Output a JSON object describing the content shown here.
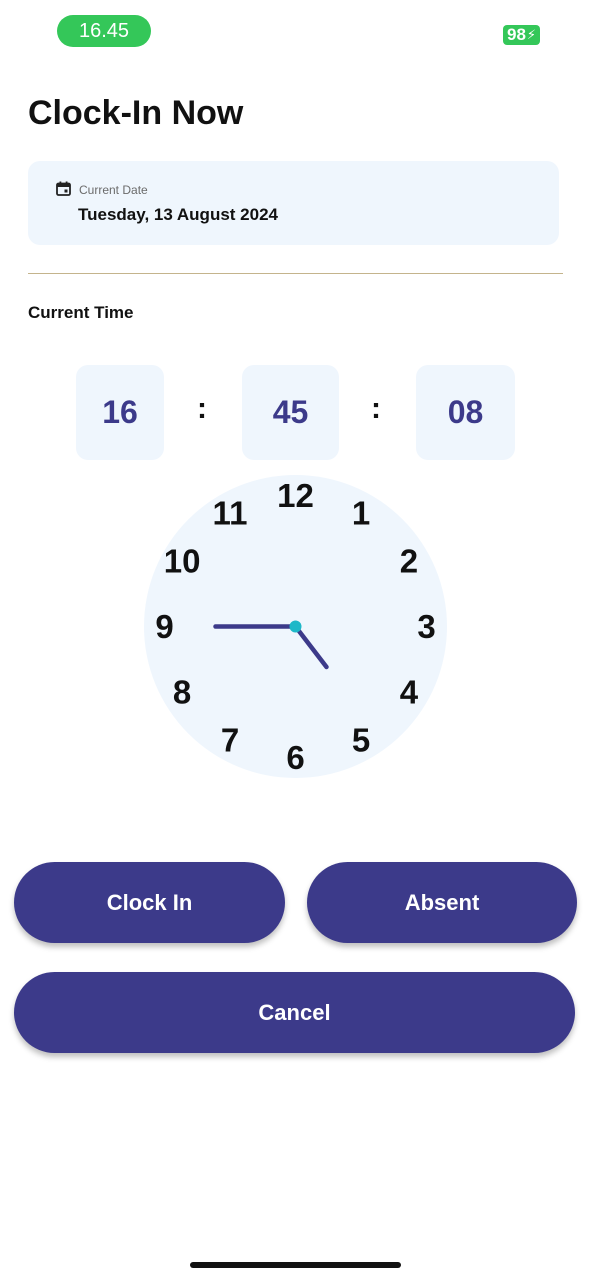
{
  "status_bar": {
    "time": "16.45",
    "battery": "98",
    "battery_icon": "bolt-icon",
    "pill_color": "#34c759"
  },
  "page": {
    "title": "Clock-In Now"
  },
  "date_card": {
    "icon": "calendar-icon",
    "label": "Current Date",
    "value": "Tuesday, 13 August 2024"
  },
  "current_time": {
    "label": "Current Time",
    "hours": "16",
    "minutes": "45",
    "seconds": "08",
    "separator": ":"
  },
  "analog_clock": {
    "numbers": [
      "12",
      "1",
      "2",
      "3",
      "4",
      "5",
      "6",
      "7",
      "8",
      "9",
      "10",
      "11"
    ],
    "hour_value": 4.75,
    "minute_value": 45,
    "face_color": "#eff6fd",
    "hand_color": "#3c3a8a",
    "center_color": "#1eb8c8"
  },
  "actions": {
    "clock_in": "Clock In",
    "absent": "Absent",
    "cancel": "Cancel",
    "button_color": "#3c3a8a"
  }
}
